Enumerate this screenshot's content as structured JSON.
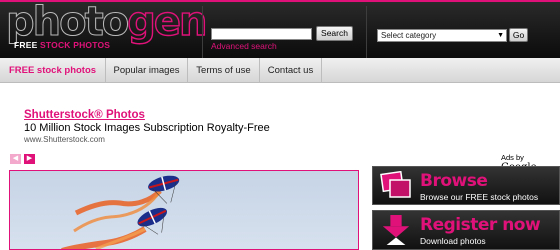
{
  "brand": {
    "logo_left": "photo",
    "logo_right": "gen",
    "tagline_left": "FREE",
    "tagline_right": "STOCK PHOTOS"
  },
  "search": {
    "value": "",
    "button_label": "Search",
    "advanced_label": "Advanced search"
  },
  "category": {
    "selected": "Select category",
    "go_label": "Go"
  },
  "nav": {
    "items": [
      {
        "label": "FREE stock photos"
      },
      {
        "label": "Popular images"
      },
      {
        "label": "Terms of use"
      },
      {
        "label": "Contact us"
      }
    ]
  },
  "ad": {
    "title": "Shutterstock® Photos",
    "description": "10 Million Stock Images Subscription Royalty-Free",
    "url": "www.Shutterstock.com",
    "ads_by_prefix": "Ads by",
    "ads_by_brand": "Google"
  },
  "carousel": {
    "prev_icon": "chevron-left-icon",
    "next_icon": "chevron-right-icon"
  },
  "sidebar": {
    "browse_title": "Browse",
    "browse_sub": "Browse our FREE stock photos",
    "register_title": "Register now",
    "register_sub": "Download photos"
  },
  "colors": {
    "accent": "#e0127a",
    "header_bg": "#111111"
  }
}
